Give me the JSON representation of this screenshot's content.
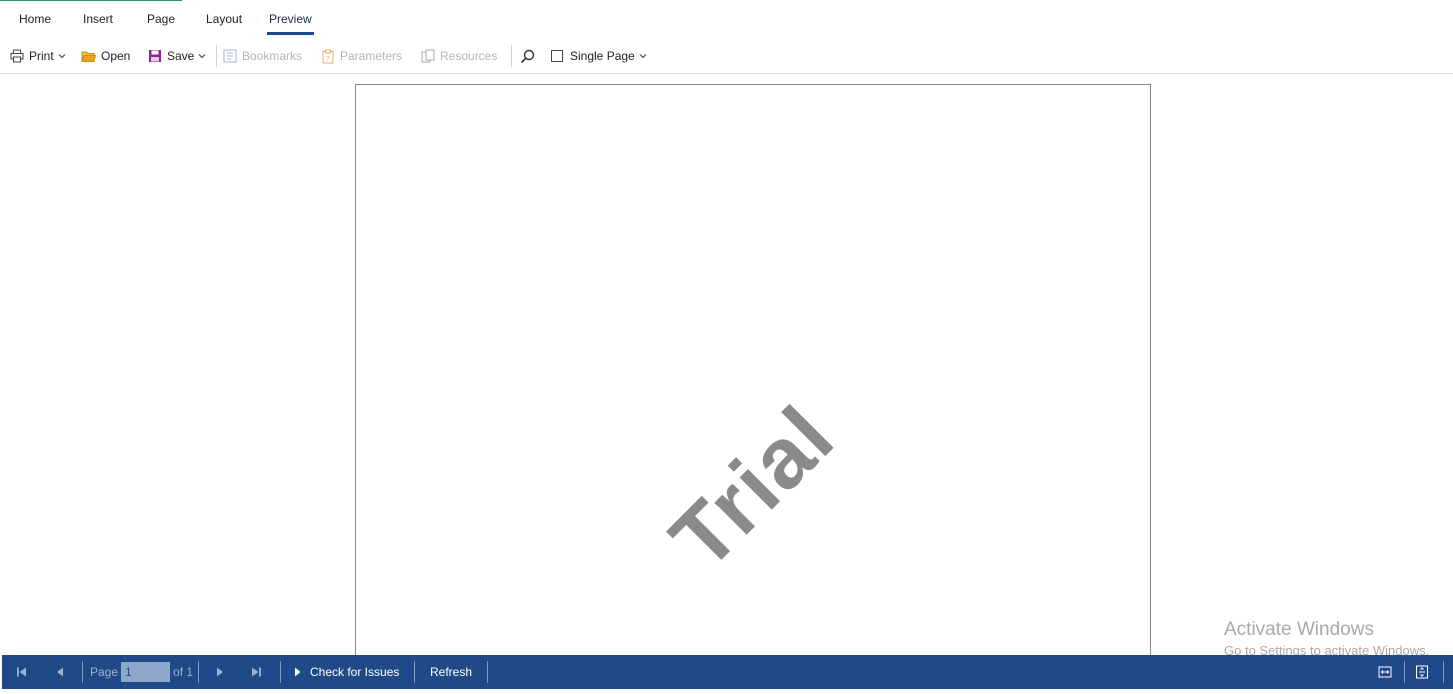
{
  "menu": {
    "tabs": [
      {
        "label": "Home"
      },
      {
        "label": "Insert"
      },
      {
        "label": "Page"
      },
      {
        "label": "Layout"
      },
      {
        "label": "Preview",
        "active": true
      }
    ]
  },
  "toolbar": {
    "print_label": "Print",
    "open_label": "Open",
    "save_label": "Save",
    "bookmarks_label": "Bookmarks",
    "parameters_label": "Parameters",
    "resources_label": "Resources",
    "single_page_label": "Single Page",
    "single_page_checked": false
  },
  "document": {
    "watermark_text": "Trial"
  },
  "os_overlay": {
    "title": "Activate Windows",
    "subtitle": "Go to Settings to activate Windows."
  },
  "status_bar": {
    "page_label": "Page",
    "page_value": "1",
    "of_label": "of 1",
    "check_issues_label": "Check for Issues",
    "refresh_label": "Refresh"
  },
  "colors": {
    "status_bar_bg": "#1f4a87",
    "tab_underline": "#1e4a8a",
    "open_icon": "#f0a020",
    "save_icon": "#8b2a8b",
    "disabled_text": "#b5b5b5"
  }
}
